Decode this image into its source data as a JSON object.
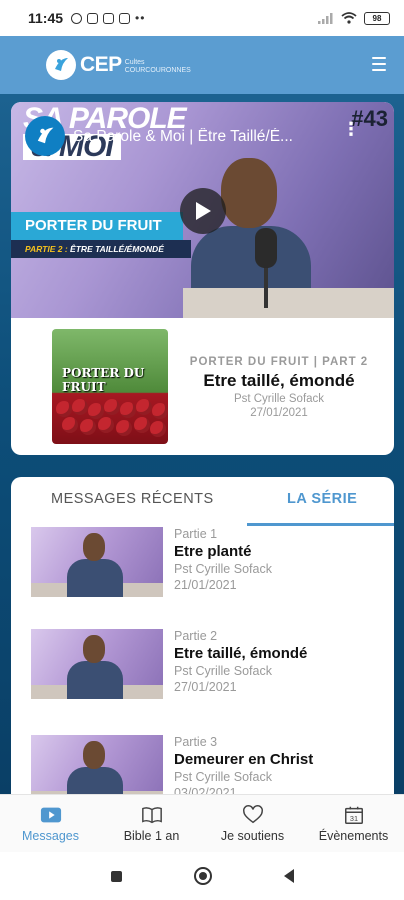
{
  "status_bar": {
    "time": "11:45",
    "battery": "98",
    "icons_left": [
      "alarm-icon",
      "mail-icon",
      "instagram-icon",
      "instagram-icon",
      "more-dots"
    ],
    "icons_right": [
      "signal-icon",
      "wifi-icon",
      "battery-icon"
    ]
  },
  "header": {
    "logo_text": "CEP",
    "logo_sub_line1": "Cultes",
    "logo_sub_line2": "COURCOURONNES",
    "menu_icon": "hamburger-icon",
    "background": "#5b9dd1"
  },
  "featured": {
    "video": {
      "title": "Sa Parole & Moi | Être Taillé/É...",
      "overlay_title_line1": "SA PAROLE",
      "overlay_title_line2": "& MOI",
      "episode_number": "#43",
      "banner_title": "PORTER DU FRUIT",
      "banner_sub_prefix": "PARTIE 2 :",
      "banner_sub": "ÊTRE TAILLÉ/ÉMONDÉ"
    },
    "thumb_label": "PORTER DU FRUIT",
    "series": "PORTER DU FRUIT | PART 2",
    "title": "Etre taillé, émondé",
    "author": "Pst Cyrille Sofack",
    "date": "27/01/2021"
  },
  "tabs": [
    {
      "label": "MESSAGES RÉCENTS",
      "active": false
    },
    {
      "label": "LA SÉRIE",
      "active": true
    }
  ],
  "episodes": [
    {
      "part": "Partie 1",
      "title": "Etre planté",
      "author": "Pst Cyrille Sofack",
      "date": "21/01/2021"
    },
    {
      "part": "Partie 2",
      "title": "Etre taillé, émondé",
      "author": "Pst Cyrille Sofack",
      "date": "27/01/2021"
    },
    {
      "part": "Partie 3",
      "title": "Demeurer en Christ",
      "author": "Pst Cyrille Sofack",
      "date": "03/02/2021"
    }
  ],
  "bottom_nav": [
    {
      "label": "Messages",
      "icon": "play-video-icon",
      "active": true
    },
    {
      "label": "Bible 1 an",
      "icon": "book-icon",
      "active": false
    },
    {
      "label": "Je soutiens",
      "icon": "heart-icon",
      "active": false
    },
    {
      "label": "Évènements",
      "icon": "calendar-icon",
      "active": false
    }
  ],
  "calendar_day": "31",
  "colors": {
    "accent": "#4f97cf",
    "header": "#5b9dd1",
    "background": "#0f4f79"
  }
}
